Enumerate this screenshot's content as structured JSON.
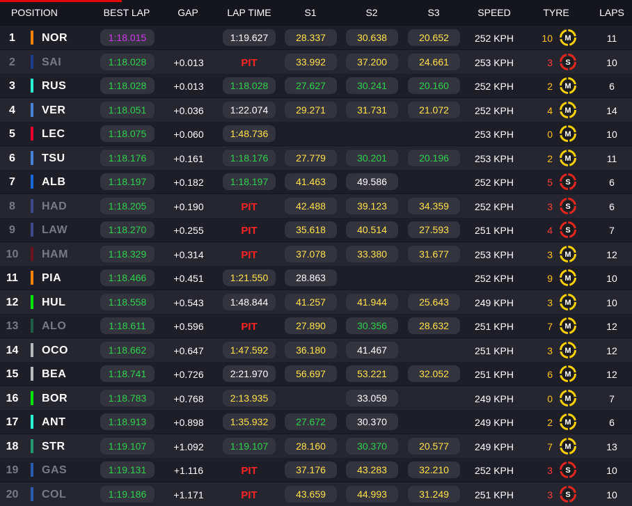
{
  "headers": {
    "position": "POSITION",
    "best_lap": "BEST LAP",
    "gap": "GAP",
    "lap_time": "LAP TIME",
    "s1": "S1",
    "s2": "S2",
    "s3": "S3",
    "speed": "SPEED",
    "tyre": "TYRE",
    "laps": "LAPS"
  },
  "colors": {
    "purple_time": "#d136f2",
    "green_time": "#2ed24e",
    "yellow_time": "#ffe24a",
    "pit_text": "#ff2424",
    "medium_tyre": "#ffd200",
    "soft_tyre": "#e8261d",
    "header_accent": "#e10600"
  },
  "drivers": [
    {
      "pos": "1",
      "code": "NOR",
      "team_color": "#ff8000",
      "out": false,
      "best_lap": "1:18.015",
      "best_color": "purple",
      "gap": "",
      "lap_time": "1:19.627",
      "lap_color": "white",
      "lap_pit": false,
      "s1": "28.337",
      "s1_color": "yellow",
      "s2": "30.638",
      "s2_color": "yellow",
      "s3": "20.652",
      "s3_color": "yellow",
      "speed": "252 KPH",
      "tyre_laps": "10",
      "tyre": "M",
      "tyre_icon": "medium-tyre-icon",
      "laps": "11"
    },
    {
      "pos": "2",
      "code": "SAI",
      "team_color": "#1e3d8f",
      "out": true,
      "best_lap": "1:18.028",
      "best_color": "green",
      "gap": "+0.013",
      "lap_time": "PIT",
      "lap_color": "",
      "lap_pit": true,
      "s1": "33.992",
      "s1_color": "yellow",
      "s2": "37.200",
      "s2_color": "yellow",
      "s3": "24.661",
      "s3_color": "yellow",
      "speed": "253 KPH",
      "tyre_laps": "3",
      "tyre": "S",
      "tyre_icon": "soft-tyre-icon",
      "laps": "10"
    },
    {
      "pos": "3",
      "code": "RUS",
      "team_color": "#27f4d2",
      "out": false,
      "best_lap": "1:18.028",
      "best_color": "green",
      "gap": "+0.013",
      "lap_time": "1:18.028",
      "lap_color": "green",
      "lap_pit": false,
      "s1": "27.627",
      "s1_color": "green",
      "s2": "30.241",
      "s2_color": "green",
      "s3": "20.160",
      "s3_color": "green",
      "speed": "252 KPH",
      "tyre_laps": "2",
      "tyre": "M",
      "tyre_icon": "medium-tyre-icon",
      "laps": "6"
    },
    {
      "pos": "4",
      "code": "VER",
      "team_color": "#4781d7",
      "out": false,
      "best_lap": "1:18.051",
      "best_color": "green",
      "gap": "+0.036",
      "lap_time": "1:22.074",
      "lap_color": "white",
      "lap_pit": false,
      "s1": "29.271",
      "s1_color": "yellow",
      "s2": "31.731",
      "s2_color": "yellow",
      "s3": "21.072",
      "s3_color": "yellow",
      "speed": "252 KPH",
      "tyre_laps": "4",
      "tyre": "M",
      "tyre_icon": "medium-tyre-icon",
      "laps": "14"
    },
    {
      "pos": "5",
      "code": "LEC",
      "team_color": "#e8002d",
      "out": false,
      "best_lap": "1:18.075",
      "best_color": "green",
      "gap": "+0.060",
      "lap_time": "1:48.736",
      "lap_color": "yellow",
      "lap_pit": false,
      "s1": "",
      "s1_color": "",
      "s2": "",
      "s2_color": "",
      "s3": "",
      "s3_color": "",
      "speed": "253 KPH",
      "tyre_laps": "0",
      "tyre": "M",
      "tyre_icon": "medium-tyre-icon",
      "laps": "10"
    },
    {
      "pos": "6",
      "code": "TSU",
      "team_color": "#4781d7",
      "out": false,
      "best_lap": "1:18.176",
      "best_color": "green",
      "gap": "+0.161",
      "lap_time": "1:18.176",
      "lap_color": "green",
      "lap_pit": false,
      "s1": "27.779",
      "s1_color": "yellow",
      "s2": "30.201",
      "s2_color": "green",
      "s3": "20.196",
      "s3_color": "green",
      "speed": "253 KPH",
      "tyre_laps": "2",
      "tyre": "M",
      "tyre_icon": "medium-tyre-icon",
      "laps": "11"
    },
    {
      "pos": "7",
      "code": "ALB",
      "team_color": "#1868db",
      "out": false,
      "best_lap": "1:18.197",
      "best_color": "green",
      "gap": "+0.182",
      "lap_time": "1:18.197",
      "lap_color": "green",
      "lap_pit": false,
      "s1": "41.463",
      "s1_color": "yellow",
      "s2": "49.586",
      "s2_color": "white",
      "s3": "",
      "s3_color": "",
      "speed": "252 KPH",
      "tyre_laps": "5",
      "tyre": "S",
      "tyre_icon": "soft-tyre-icon",
      "laps": "6"
    },
    {
      "pos": "8",
      "code": "HAD",
      "team_color": "#3c4a8a",
      "out": true,
      "best_lap": "1:18.205",
      "best_color": "green",
      "gap": "+0.190",
      "lap_time": "PIT",
      "lap_color": "",
      "lap_pit": true,
      "s1": "42.488",
      "s1_color": "yellow",
      "s2": "39.123",
      "s2_color": "yellow",
      "s3": "34.359",
      "s3_color": "yellow",
      "speed": "252 KPH",
      "tyre_laps": "3",
      "tyre": "S",
      "tyre_icon": "soft-tyre-icon",
      "laps": "6"
    },
    {
      "pos": "9",
      "code": "LAW",
      "team_color": "#3c4a8a",
      "out": true,
      "best_lap": "1:18.270",
      "best_color": "green",
      "gap": "+0.255",
      "lap_time": "PIT",
      "lap_color": "",
      "lap_pit": true,
      "s1": "35.618",
      "s1_color": "yellow",
      "s2": "40.514",
      "s2_color": "yellow",
      "s3": "27.593",
      "s3_color": "yellow",
      "speed": "251 KPH",
      "tyre_laps": "4",
      "tyre": "S",
      "tyre_icon": "soft-tyre-icon",
      "laps": "7"
    },
    {
      "pos": "10",
      "code": "HAM",
      "team_color": "#6b1420",
      "out": true,
      "best_lap": "1:18.329",
      "best_color": "green",
      "gap": "+0.314",
      "lap_time": "PIT",
      "lap_color": "",
      "lap_pit": true,
      "s1": "37.078",
      "s1_color": "yellow",
      "s2": "33.380",
      "s2_color": "yellow",
      "s3": "31.677",
      "s3_color": "yellow",
      "speed": "253 KPH",
      "tyre_laps": "3",
      "tyre": "M",
      "tyre_icon": "medium-tyre-icon",
      "laps": "12"
    },
    {
      "pos": "11",
      "code": "PIA",
      "team_color": "#ff8000",
      "out": false,
      "best_lap": "1:18.466",
      "best_color": "green",
      "gap": "+0.451",
      "lap_time": "1:21.550",
      "lap_color": "yellow",
      "lap_pit": false,
      "s1": "28.863",
      "s1_color": "white",
      "s2": "",
      "s2_color": "",
      "s3": "",
      "s3_color": "",
      "speed": "252 KPH",
      "tyre_laps": "9",
      "tyre": "M",
      "tyre_icon": "medium-tyre-icon",
      "laps": "10"
    },
    {
      "pos": "12",
      "code": "HUL",
      "team_color": "#00e701",
      "out": false,
      "best_lap": "1:18.558",
      "best_color": "green",
      "gap": "+0.543",
      "lap_time": "1:48.844",
      "lap_color": "white",
      "lap_pit": false,
      "s1": "41.257",
      "s1_color": "yellow",
      "s2": "41.944",
      "s2_color": "yellow",
      "s3": "25.643",
      "s3_color": "yellow",
      "speed": "249 KPH",
      "tyre_laps": "3",
      "tyre": "M",
      "tyre_icon": "medium-tyre-icon",
      "laps": "10"
    },
    {
      "pos": "13",
      "code": "ALO",
      "team_color": "#1f5c45",
      "out": true,
      "best_lap": "1:18.611",
      "best_color": "green",
      "gap": "+0.596",
      "lap_time": "PIT",
      "lap_color": "",
      "lap_pit": true,
      "s1": "27.890",
      "s1_color": "yellow",
      "s2": "30.356",
      "s2_color": "green",
      "s3": "28.632",
      "s3_color": "yellow",
      "speed": "251 KPH",
      "tyre_laps": "7",
      "tyre": "M",
      "tyre_icon": "medium-tyre-icon",
      "laps": "12"
    },
    {
      "pos": "14",
      "code": "OCO",
      "team_color": "#b6babd",
      "out": false,
      "best_lap": "1:18.662",
      "best_color": "green",
      "gap": "+0.647",
      "lap_time": "1:47.592",
      "lap_color": "yellow",
      "lap_pit": false,
      "s1": "36.180",
      "s1_color": "yellow",
      "s2": "41.467",
      "s2_color": "white",
      "s3": "",
      "s3_color": "",
      "speed": "251 KPH",
      "tyre_laps": "3",
      "tyre": "M",
      "tyre_icon": "medium-tyre-icon",
      "laps": "12"
    },
    {
      "pos": "15",
      "code": "BEA",
      "team_color": "#b6babd",
      "out": false,
      "best_lap": "1:18.741",
      "best_color": "green",
      "gap": "+0.726",
      "lap_time": "2:21.970",
      "lap_color": "white",
      "lap_pit": false,
      "s1": "56.697",
      "s1_color": "yellow",
      "s2": "53.221",
      "s2_color": "yellow",
      "s3": "32.052",
      "s3_color": "yellow",
      "speed": "251 KPH",
      "tyre_laps": "6",
      "tyre": "M",
      "tyre_icon": "medium-tyre-icon",
      "laps": "12"
    },
    {
      "pos": "16",
      "code": "BOR",
      "team_color": "#00e701",
      "out": false,
      "best_lap": "1:18.783",
      "best_color": "green",
      "gap": "+0.768",
      "lap_time": "2:13.935",
      "lap_color": "yellow",
      "lap_pit": false,
      "s1": "",
      "s1_color": "",
      "s2": "33.059",
      "s2_color": "white",
      "s3": "",
      "s3_color": "",
      "speed": "249 KPH",
      "tyre_laps": "0",
      "tyre": "M",
      "tyre_icon": "medium-tyre-icon",
      "laps": "7"
    },
    {
      "pos": "17",
      "code": "ANT",
      "team_color": "#27f4d2",
      "out": false,
      "best_lap": "1:18.913",
      "best_color": "green",
      "gap": "+0.898",
      "lap_time": "1:35.932",
      "lap_color": "yellow",
      "lap_pit": false,
      "s1": "27.672",
      "s1_color": "green",
      "s2": "30.370",
      "s2_color": "white",
      "s3": "",
      "s3_color": "",
      "speed": "249 KPH",
      "tyre_laps": "2",
      "tyre": "M",
      "tyre_icon": "medium-tyre-icon",
      "laps": "6"
    },
    {
      "pos": "18",
      "code": "STR",
      "team_color": "#229971",
      "out": false,
      "best_lap": "1:19.107",
      "best_color": "green",
      "gap": "+1.092",
      "lap_time": "1:19.107",
      "lap_color": "green",
      "lap_pit": false,
      "s1": "28.160",
      "s1_color": "yellow",
      "s2": "30.370",
      "s2_color": "green",
      "s3": "20.577",
      "s3_color": "yellow",
      "speed": "249 KPH",
      "tyre_laps": "7",
      "tyre": "M",
      "tyre_icon": "medium-tyre-icon",
      "laps": "13"
    },
    {
      "pos": "19",
      "code": "GAS",
      "team_color": "#2b5bb0",
      "out": true,
      "best_lap": "1:19.131",
      "best_color": "green",
      "gap": "+1.116",
      "lap_time": "PIT",
      "lap_color": "",
      "lap_pit": true,
      "s1": "37.176",
      "s1_color": "yellow",
      "s2": "43.283",
      "s2_color": "yellow",
      "s3": "32.210",
      "s3_color": "yellow",
      "speed": "252 KPH",
      "tyre_laps": "3",
      "tyre": "S",
      "tyre_icon": "soft-tyre-icon",
      "laps": "10"
    },
    {
      "pos": "20",
      "code": "COL",
      "team_color": "#2b5bb0",
      "out": true,
      "best_lap": "1:19.186",
      "best_color": "green",
      "gap": "+1.171",
      "lap_time": "PIT",
      "lap_color": "",
      "lap_pit": true,
      "s1": "43.659",
      "s1_color": "yellow",
      "s2": "44.993",
      "s2_color": "yellow",
      "s3": "31.249",
      "s3_color": "yellow",
      "speed": "251 KPH",
      "tyre_laps": "3",
      "tyre": "S",
      "tyre_icon": "soft-tyre-icon",
      "laps": "10"
    }
  ]
}
